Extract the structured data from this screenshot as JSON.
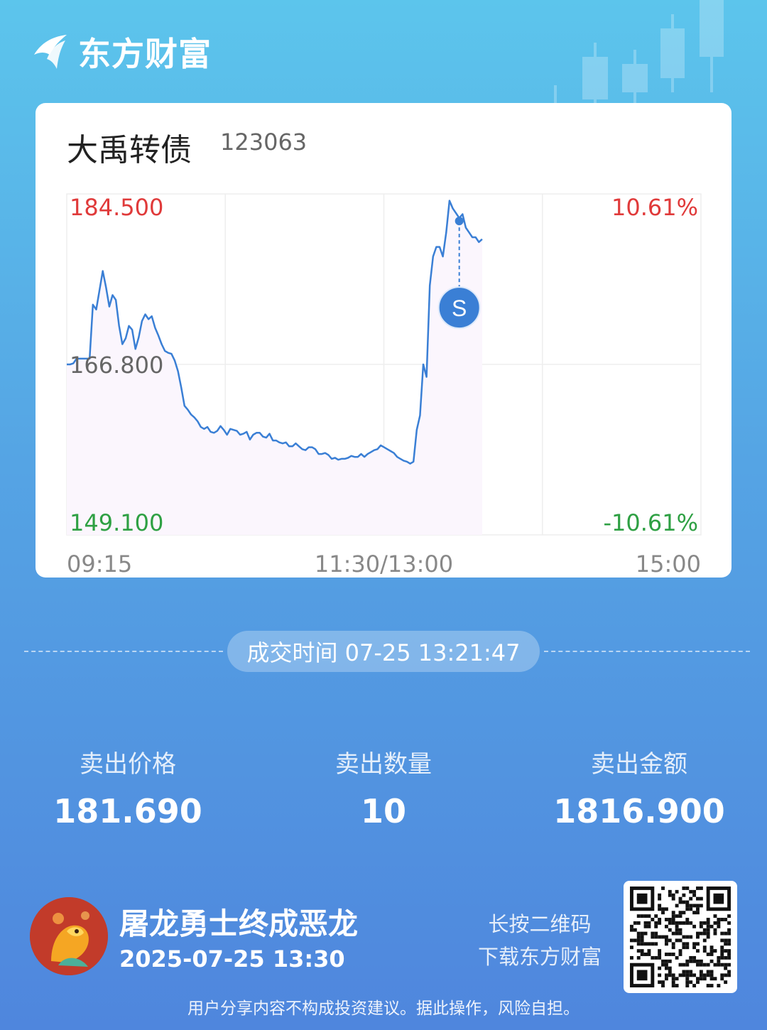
{
  "brand": {
    "name": "东方财富"
  },
  "stock": {
    "name": "大禹转债",
    "code": "123063"
  },
  "chart_data": {
    "type": "line",
    "y_top_label": "184.500",
    "y_mid_label": "166.800",
    "y_bottom_label": "149.100",
    "pct_top_label": "10.61%",
    "pct_bottom_label": "-10.61%",
    "x_labels": [
      "09:15",
      "11:30/13:00",
      "15:00"
    ],
    "ylim": [
      149.1,
      184.5
    ],
    "prev_close": 166.8,
    "line_color": "#3a7fd5",
    "marker_label": "S",
    "marker_price": 181.69,
    "price_series": [
      166.8,
      166.8,
      166.9,
      167.4,
      167.4,
      167.4,
      167.4,
      167.4,
      173.0,
      172.5,
      174.5,
      176.5,
      174.8,
      172.8,
      174.0,
      173.5,
      170.8,
      168.9,
      169.5,
      170.8,
      170.4,
      168.4,
      169.6,
      171.3,
      172.0,
      171.5,
      171.8,
      170.6,
      169.8,
      168.9,
      168.2,
      168.0,
      167.9,
      167.2,
      166.1,
      164.4,
      162.5,
      162.1,
      161.6,
      161.3,
      160.9,
      160.3,
      160.1,
      160.3,
      159.8,
      159.7,
      159.9,
      160.4,
      160.0,
      159.5,
      160.1,
      160.0,
      159.9,
      159.5,
      159.6,
      159.8,
      159.0,
      159.5,
      159.7,
      159.7,
      159.3,
      159.2,
      159.6,
      158.9,
      158.9,
      158.7,
      158.6,
      158.7,
      158.3,
      158.3,
      158.6,
      158.3,
      158.0,
      157.9,
      158.2,
      158.2,
      158.0,
      157.5,
      157.5,
      157.6,
      157.4,
      157.0,
      157.1,
      156.9,
      157.0,
      157.0,
      157.1,
      157.3,
      157.2,
      157.2,
      157.5,
      157.2,
      157.5,
      157.7,
      157.9,
      158.0,
      158.4,
      158.2,
      158.0,
      157.8,
      157.6,
      157.2,
      157.0,
      156.8,
      156.7,
      156.5,
      156.7,
      160.0,
      161.5,
      166.8,
      165.5,
      175.0,
      178.0,
      179.0,
      179.0,
      178.0,
      180.5,
      183.8,
      183.0,
      182.5,
      182.0,
      182.4,
      181.0,
      180.5,
      180.0,
      180.0,
      179.5,
      179.8
    ],
    "range_session_end_index": 107
  },
  "trade": {
    "time_label": "成交时间 07-25 13:21:47",
    "price_label": "卖出价格",
    "price_value": "181.690",
    "qty_label": "卖出数量",
    "qty_value": "10",
    "amount_label": "卖出金额",
    "amount_value": "1816.900"
  },
  "user": {
    "name": "屠龙勇士终成恶龙",
    "date": "2025-07-25 13:30"
  },
  "qr": {
    "hint_line1": "长按二维码",
    "hint_line2": "下载东方财富"
  },
  "disclaimer": "用户分享内容不构成投资建议。据此操作，风险自担。",
  "colors": {
    "up": "#e03a3a",
    "down": "#2ea043",
    "neutral": "#666666"
  }
}
